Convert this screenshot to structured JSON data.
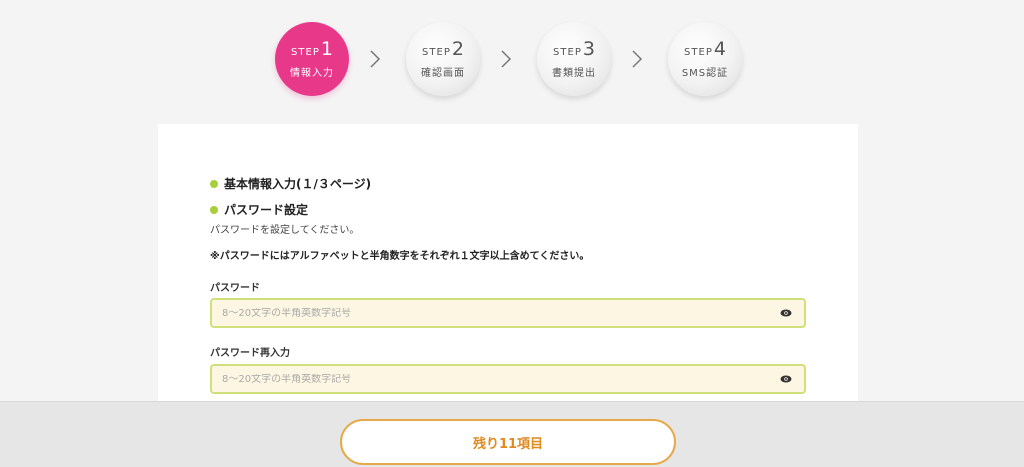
{
  "steps": [
    {
      "word": "STEP",
      "num": "1",
      "label": "情報入力",
      "active": true
    },
    {
      "word": "STEP",
      "num": "2",
      "label": "確認画面",
      "active": false
    },
    {
      "word": "STEP",
      "num": "3",
      "label": "書類提出",
      "active": false
    },
    {
      "word": "STEP",
      "num": "4",
      "label": "SMS認証",
      "active": false
    }
  ],
  "form": {
    "section_basic": "基本情報入力(１/３ページ)",
    "section_password": "パスワード設定",
    "password_help": "パスワードを設定してください。",
    "password_note": "※パスワードにはアルファベットと半角数字をそれぞれ１文字以上含めてください。",
    "password_label": "パスワード",
    "password_placeholder": "8～20文字の半角英数字記号",
    "password_value": "",
    "password_confirm_label": "パスワード再入力",
    "password_confirm_placeholder": "8～20文字の半角英数字記号",
    "password_confirm_value": ""
  },
  "footer": {
    "remaining_label": "残り11項目"
  },
  "colors": {
    "active_step": "#e8388a",
    "section_dot": "#a6cf3a",
    "field_border": "#cfe07a",
    "field_bg": "#fdf6e3",
    "button_border": "#e6a94a",
    "button_text": "#e08a20"
  },
  "icons": {
    "chevron": "chevron-right-icon",
    "eye": "eye-icon"
  }
}
